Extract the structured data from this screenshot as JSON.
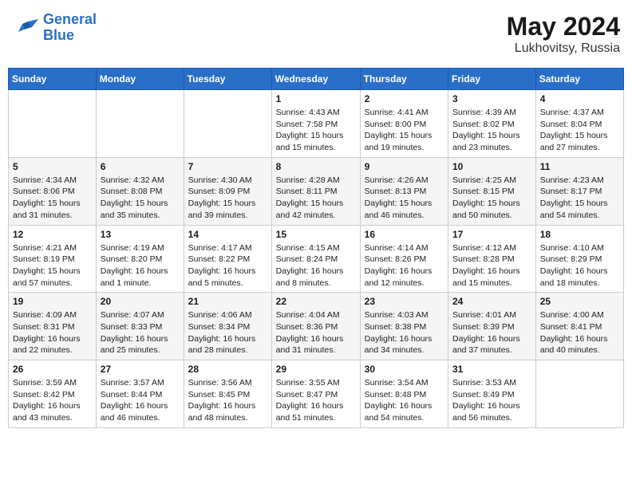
{
  "header": {
    "logo_line1": "General",
    "logo_line2": "Blue",
    "month": "May 2024",
    "location": "Lukhovitsy, Russia"
  },
  "days_of_week": [
    "Sunday",
    "Monday",
    "Tuesday",
    "Wednesday",
    "Thursday",
    "Friday",
    "Saturday"
  ],
  "weeks": [
    [
      {
        "day": "",
        "info": ""
      },
      {
        "day": "",
        "info": ""
      },
      {
        "day": "",
        "info": ""
      },
      {
        "day": "1",
        "info": "Sunrise: 4:43 AM\nSunset: 7:58 PM\nDaylight: 15 hours\nand 15 minutes."
      },
      {
        "day": "2",
        "info": "Sunrise: 4:41 AM\nSunset: 8:00 PM\nDaylight: 15 hours\nand 19 minutes."
      },
      {
        "day": "3",
        "info": "Sunrise: 4:39 AM\nSunset: 8:02 PM\nDaylight: 15 hours\nand 23 minutes."
      },
      {
        "day": "4",
        "info": "Sunrise: 4:37 AM\nSunset: 8:04 PM\nDaylight: 15 hours\nand 27 minutes."
      }
    ],
    [
      {
        "day": "5",
        "info": "Sunrise: 4:34 AM\nSunset: 8:06 PM\nDaylight: 15 hours\nand 31 minutes."
      },
      {
        "day": "6",
        "info": "Sunrise: 4:32 AM\nSunset: 8:08 PM\nDaylight: 15 hours\nand 35 minutes."
      },
      {
        "day": "7",
        "info": "Sunrise: 4:30 AM\nSunset: 8:09 PM\nDaylight: 15 hours\nand 39 minutes."
      },
      {
        "day": "8",
        "info": "Sunrise: 4:28 AM\nSunset: 8:11 PM\nDaylight: 15 hours\nand 42 minutes."
      },
      {
        "day": "9",
        "info": "Sunrise: 4:26 AM\nSunset: 8:13 PM\nDaylight: 15 hours\nand 46 minutes."
      },
      {
        "day": "10",
        "info": "Sunrise: 4:25 AM\nSunset: 8:15 PM\nDaylight: 15 hours\nand 50 minutes."
      },
      {
        "day": "11",
        "info": "Sunrise: 4:23 AM\nSunset: 8:17 PM\nDaylight: 15 hours\nand 54 minutes."
      }
    ],
    [
      {
        "day": "12",
        "info": "Sunrise: 4:21 AM\nSunset: 8:19 PM\nDaylight: 15 hours\nand 57 minutes."
      },
      {
        "day": "13",
        "info": "Sunrise: 4:19 AM\nSunset: 8:20 PM\nDaylight: 16 hours\nand 1 minute."
      },
      {
        "day": "14",
        "info": "Sunrise: 4:17 AM\nSunset: 8:22 PM\nDaylight: 16 hours\nand 5 minutes."
      },
      {
        "day": "15",
        "info": "Sunrise: 4:15 AM\nSunset: 8:24 PM\nDaylight: 16 hours\nand 8 minutes."
      },
      {
        "day": "16",
        "info": "Sunrise: 4:14 AM\nSunset: 8:26 PM\nDaylight: 16 hours\nand 12 minutes."
      },
      {
        "day": "17",
        "info": "Sunrise: 4:12 AM\nSunset: 8:28 PM\nDaylight: 16 hours\nand 15 minutes."
      },
      {
        "day": "18",
        "info": "Sunrise: 4:10 AM\nSunset: 8:29 PM\nDaylight: 16 hours\nand 18 minutes."
      }
    ],
    [
      {
        "day": "19",
        "info": "Sunrise: 4:09 AM\nSunset: 8:31 PM\nDaylight: 16 hours\nand 22 minutes."
      },
      {
        "day": "20",
        "info": "Sunrise: 4:07 AM\nSunset: 8:33 PM\nDaylight: 16 hours\nand 25 minutes."
      },
      {
        "day": "21",
        "info": "Sunrise: 4:06 AM\nSunset: 8:34 PM\nDaylight: 16 hours\nand 28 minutes."
      },
      {
        "day": "22",
        "info": "Sunrise: 4:04 AM\nSunset: 8:36 PM\nDaylight: 16 hours\nand 31 minutes."
      },
      {
        "day": "23",
        "info": "Sunrise: 4:03 AM\nSunset: 8:38 PM\nDaylight: 16 hours\nand 34 minutes."
      },
      {
        "day": "24",
        "info": "Sunrise: 4:01 AM\nSunset: 8:39 PM\nDaylight: 16 hours\nand 37 minutes."
      },
      {
        "day": "25",
        "info": "Sunrise: 4:00 AM\nSunset: 8:41 PM\nDaylight: 16 hours\nand 40 minutes."
      }
    ],
    [
      {
        "day": "26",
        "info": "Sunrise: 3:59 AM\nSunset: 8:42 PM\nDaylight: 16 hours\nand 43 minutes."
      },
      {
        "day": "27",
        "info": "Sunrise: 3:57 AM\nSunset: 8:44 PM\nDaylight: 16 hours\nand 46 minutes."
      },
      {
        "day": "28",
        "info": "Sunrise: 3:56 AM\nSunset: 8:45 PM\nDaylight: 16 hours\nand 48 minutes."
      },
      {
        "day": "29",
        "info": "Sunrise: 3:55 AM\nSunset: 8:47 PM\nDaylight: 16 hours\nand 51 minutes."
      },
      {
        "day": "30",
        "info": "Sunrise: 3:54 AM\nSunset: 8:48 PM\nDaylight: 16 hours\nand 54 minutes."
      },
      {
        "day": "31",
        "info": "Sunrise: 3:53 AM\nSunset: 8:49 PM\nDaylight: 16 hours\nand 56 minutes."
      },
      {
        "day": "",
        "info": ""
      }
    ]
  ]
}
